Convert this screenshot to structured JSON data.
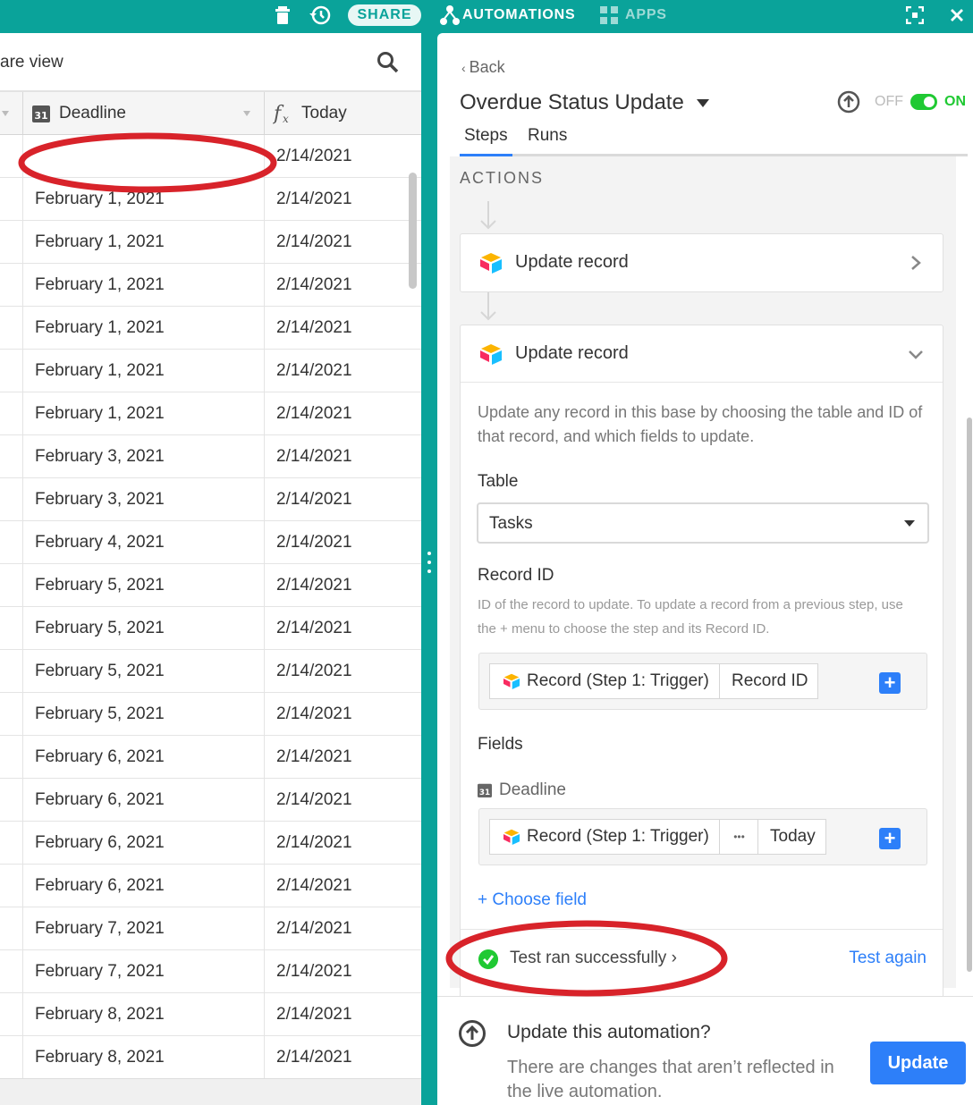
{
  "topbar": {
    "share_label": "SHARE",
    "automations_label": "AUTOMATIONS",
    "apps_label": "APPS",
    "accent_color": "#0aa39a"
  },
  "grid": {
    "view_name": "are view",
    "columns": [
      {
        "name": "Deadline",
        "icon": "calendar-icon"
      },
      {
        "name": "Today",
        "icon": "formula-icon"
      }
    ],
    "rows": [
      {
        "deadline": "",
        "today": "2/14/2021"
      },
      {
        "deadline": "February 1, 2021",
        "today": "2/14/2021"
      },
      {
        "deadline": "February 1, 2021",
        "today": "2/14/2021"
      },
      {
        "deadline": "February 1, 2021",
        "today": "2/14/2021"
      },
      {
        "deadline": "February 1, 2021",
        "today": "2/14/2021"
      },
      {
        "deadline": "February 1, 2021",
        "today": "2/14/2021"
      },
      {
        "deadline": "February 1, 2021",
        "today": "2/14/2021"
      },
      {
        "deadline": "February 3, 2021",
        "today": "2/14/2021"
      },
      {
        "deadline": "February 3, 2021",
        "today": "2/14/2021"
      },
      {
        "deadline": "February 4, 2021",
        "today": "2/14/2021"
      },
      {
        "deadline": "February 5, 2021",
        "today": "2/14/2021"
      },
      {
        "deadline": "February 5, 2021",
        "today": "2/14/2021"
      },
      {
        "deadline": "February 5, 2021",
        "today": "2/14/2021"
      },
      {
        "deadline": "February 5, 2021",
        "today": "2/14/2021"
      },
      {
        "deadline": "February 6, 2021",
        "today": "2/14/2021"
      },
      {
        "deadline": "February 6, 2021",
        "today": "2/14/2021"
      },
      {
        "deadline": "February 6, 2021",
        "today": "2/14/2021"
      },
      {
        "deadline": "February 6, 2021",
        "today": "2/14/2021"
      },
      {
        "deadline": "February 7, 2021",
        "today": "2/14/2021"
      },
      {
        "deadline": "February 7, 2021",
        "today": "2/14/2021"
      },
      {
        "deadline": "February 8, 2021",
        "today": "2/14/2021"
      },
      {
        "deadline": "February 8, 2021",
        "today": "2/14/2021"
      }
    ]
  },
  "panel": {
    "back_label": "Back",
    "automation_title": "Overdue Status Update",
    "off_label": "OFF",
    "on_label": "ON",
    "tabs": [
      "Steps",
      "Runs"
    ],
    "section_label": "ACTIONS",
    "action1_title": "Update record",
    "action2": {
      "title": "Update record",
      "description": "Update any record in this base by choosing the table and ID of that record, and which fields to update.",
      "table_label": "Table",
      "table_value": "Tasks",
      "record_id_label": "Record ID",
      "record_id_hint": "ID of the record to update. To update a record from a previous step, use the + menu to choose the step and its Record ID.",
      "record_id_token_source": "Record (Step 1: Trigger)",
      "record_id_token_field": "Record ID",
      "fields_label": "Fields",
      "field_name": "Deadline",
      "field_token_source": "Record (Step 1: Trigger)",
      "field_token_more": "•••",
      "field_token_field": "Today",
      "choose_field_label": "+ Choose field",
      "test_status": "Test ran successfully",
      "test_again_label": "Test again"
    },
    "update_bar": {
      "heading": "Update this automation?",
      "text": "There are changes that aren’t reflected in the live automation.",
      "button_label": "Update"
    }
  },
  "colors": {
    "primary_blue": "#2d7ff9",
    "success_green": "#20c933",
    "annotation_red": "#d8232a"
  }
}
